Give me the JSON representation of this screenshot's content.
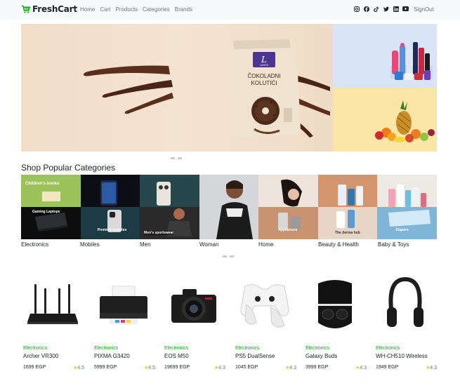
{
  "nav": {
    "brand": "FreshCart",
    "links": [
      "Home",
      "Cart",
      "Products",
      "Categories",
      "Brands"
    ],
    "social_icons": [
      "instagram-icon",
      "facebook-icon",
      "tiktok-icon",
      "twitter-icon",
      "linkedin-icon",
      "youtube-icon"
    ],
    "signout": "SignOut"
  },
  "hero": {
    "bag_text_1": "ČOKOLADNI",
    "bag_text_2": "KOLUTIĆI",
    "bag_logo": "LASTA"
  },
  "categories": {
    "title": "Shop Popular Categories",
    "items": [
      {
        "label": "Electronics",
        "caption_top": "Children's books",
        "caption_bottom": "Gaming Laptops"
      },
      {
        "label": "Mobiles",
        "caption_top": "",
        "caption_bottom": "Premium mobiles"
      },
      {
        "label": "Men",
        "caption_top": "",
        "caption_bottom": "Men's sportswear"
      },
      {
        "label": "Woman",
        "caption_top": "",
        "caption_bottom": ""
      },
      {
        "label": "Home",
        "caption_top": "",
        "caption_bottom": "Appliances"
      },
      {
        "label": "Beauty & Health",
        "caption_top": "",
        "caption_bottom": "The derma hub"
      },
      {
        "label": "Baby & Toys",
        "caption_top": "",
        "caption_bottom": "Diapers"
      }
    ]
  },
  "products": [
    {
      "category": "Electronics",
      "name": "Archer VR300",
      "price": "1699 EGP",
      "rating": "4.5",
      "icon": "router-icon"
    },
    {
      "category": "Electronics",
      "name": "PIXMA G3420",
      "price": "5999 EGP",
      "rating": "4.5",
      "icon": "printer-icon"
    },
    {
      "category": "Electronics",
      "name": "EOS M50",
      "price": "19699 EGP",
      "rating": "4.3",
      "icon": "camera-icon"
    },
    {
      "category": "Electronics",
      "name": "PS5 DualSense",
      "price": "1045 EGP",
      "rating": "4.3",
      "icon": "controller-icon"
    },
    {
      "category": "Electronics",
      "name": "Galaxy Buds",
      "price": "3999 EGP",
      "rating": "4.3",
      "icon": "earbuds-icon"
    },
    {
      "category": "Electronics",
      "name": "WH-CH510 Wireless",
      "price": "1949 EGP",
      "rating": "4.3",
      "icon": "headphones-icon"
    }
  ],
  "colors": {
    "accent": "#0aad0a",
    "star": "#ffc908",
    "nav_bg": "#f8f9fa"
  }
}
